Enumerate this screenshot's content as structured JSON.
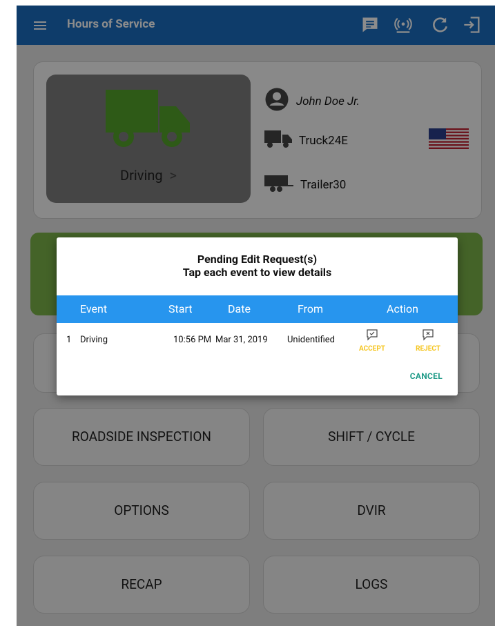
{
  "appbar": {
    "title": "Hours of Service",
    "icons": [
      "menu-icon",
      "message-icon",
      "eld-signal-icon",
      "refresh-icon",
      "logout-icon"
    ]
  },
  "status": {
    "label": "Driving",
    "chevron": ">"
  },
  "driver": {
    "name": "John Doe Jr.",
    "truck": "Truck24E",
    "trailer": "Trailer30"
  },
  "buttons": {
    "roadside": "ROADSIDE INSPECTION",
    "shift": "SHIFT / CYCLE",
    "options": "OPTIONS",
    "dvir": "DVIR",
    "recap": "RECAP",
    "logs": "LOGS"
  },
  "dialog": {
    "title_line1": "Pending Edit Request(s)",
    "title_line2": "Tap each event to view details",
    "headers": {
      "event": "Event",
      "start": "Start",
      "date": "Date",
      "from": "From",
      "action": "Action"
    },
    "rows": [
      {
        "index": "1",
        "event": "Driving",
        "start": "10:56 PM",
        "date": "Mar 31, 2019",
        "from": "Unidentified",
        "accept": "ACCEPT",
        "reject": "REJECT"
      }
    ],
    "cancel": "CANCEL"
  },
  "colors": {
    "appbar": "#1a6ec2",
    "truck_green": "#54a42a",
    "table_header": "#2795ee",
    "action_yellow": "#f5c51e",
    "cancel_teal": "#1e9a87"
  }
}
